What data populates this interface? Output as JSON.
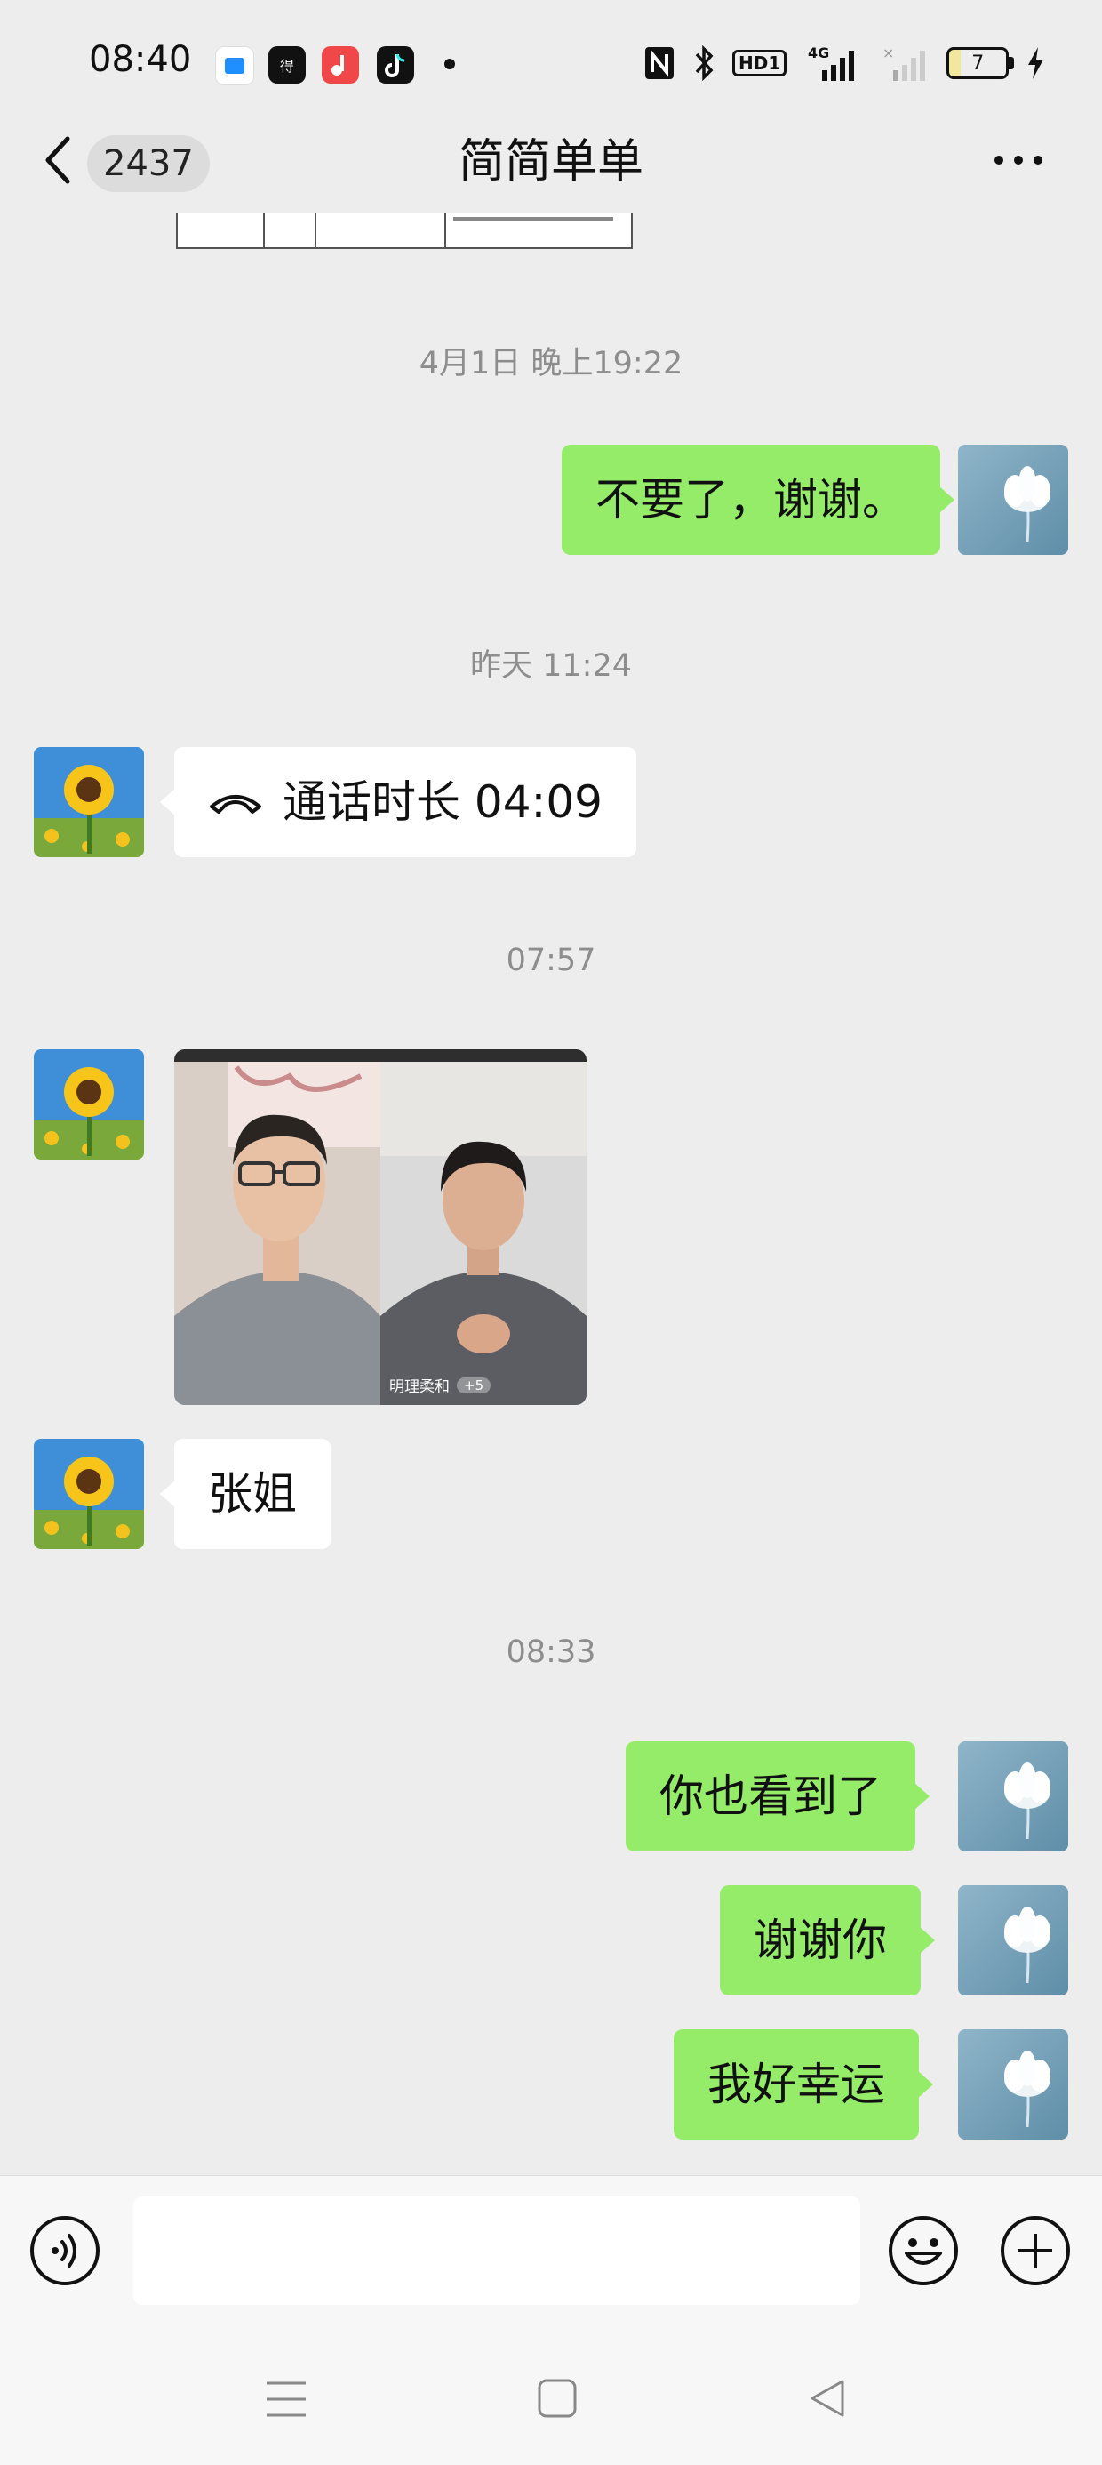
{
  "status_bar": {
    "time": "08:40",
    "network_label": "4G",
    "hd_label": "HD1",
    "battery_level": "7",
    "icons": [
      "app-icon-blue",
      "dewu-app-icon",
      "music-app-icon",
      "tiktok-icon",
      "nfc-icon",
      "bluetooth-icon",
      "signal-icon",
      "battery-icon",
      "charging-icon"
    ]
  },
  "header": {
    "back_count": "2437",
    "title": "简简单单"
  },
  "messages": {
    "ts1": "4月1日 晚上19:22",
    "m1": "不要了，谢谢。",
    "ts2": "昨天 11:24",
    "call_text": "通话时长 04:09",
    "ts3": "07:57",
    "video_user": "明理柔和",
    "video_more": "+5",
    "m2": "张姐",
    "ts4": "08:33",
    "m3": "你也看到了",
    "m4": "谢谢你",
    "m5": "我好幸运"
  },
  "input": {
    "placeholder": ""
  },
  "colors": {
    "my_bubble": "#95ec69",
    "their_bubble": "#ffffff",
    "background": "#ededed",
    "timestamp": "#8d8d8d"
  }
}
